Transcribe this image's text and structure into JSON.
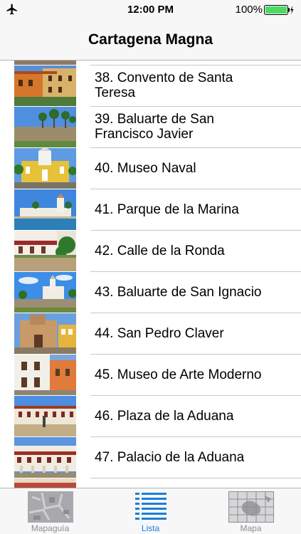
{
  "status_bar": {
    "time": "12:00 PM",
    "battery_percent": "100%",
    "airplane_icon": "airplane-icon",
    "battery_icon": "battery-charging-icon"
  },
  "nav": {
    "title": "Cartagena Magna"
  },
  "list": {
    "items": [
      {
        "label": "38. Convento de Santa Teresa",
        "line1": "38. Convento de Santa",
        "line2": "Teresa"
      },
      {
        "label": "39. Baluarte de San Francisco Javier",
        "line1": "39. Baluarte de San",
        "line2": "Francisco Javier"
      },
      {
        "label": "40. Museo Naval"
      },
      {
        "label": "41. Parque de la Marina"
      },
      {
        "label": "42. Calle de la Ronda"
      },
      {
        "label": "43. Baluarte de San Ignacio"
      },
      {
        "label": "44. San Pedro Claver"
      },
      {
        "label": "45. Museo de Arte Moderno"
      },
      {
        "label": "46. Plaza de la Aduana"
      },
      {
        "label": "47. Palacio de la Aduana"
      }
    ]
  },
  "tab_bar": {
    "tabs": [
      {
        "label": "Mapaguía",
        "icon": "guide-map-icon",
        "active": false
      },
      {
        "label": "Lista",
        "icon": "list-icon",
        "active": true
      },
      {
        "label": "Mapa",
        "icon": "map-icon",
        "active": false
      }
    ]
  },
  "colors": {
    "accent": "#1a7fd9",
    "inactive_tab": "#8e8e93",
    "separator": "#c8c7cc",
    "bar_background": "#f7f7f7",
    "battery_green": "#4cd964"
  }
}
